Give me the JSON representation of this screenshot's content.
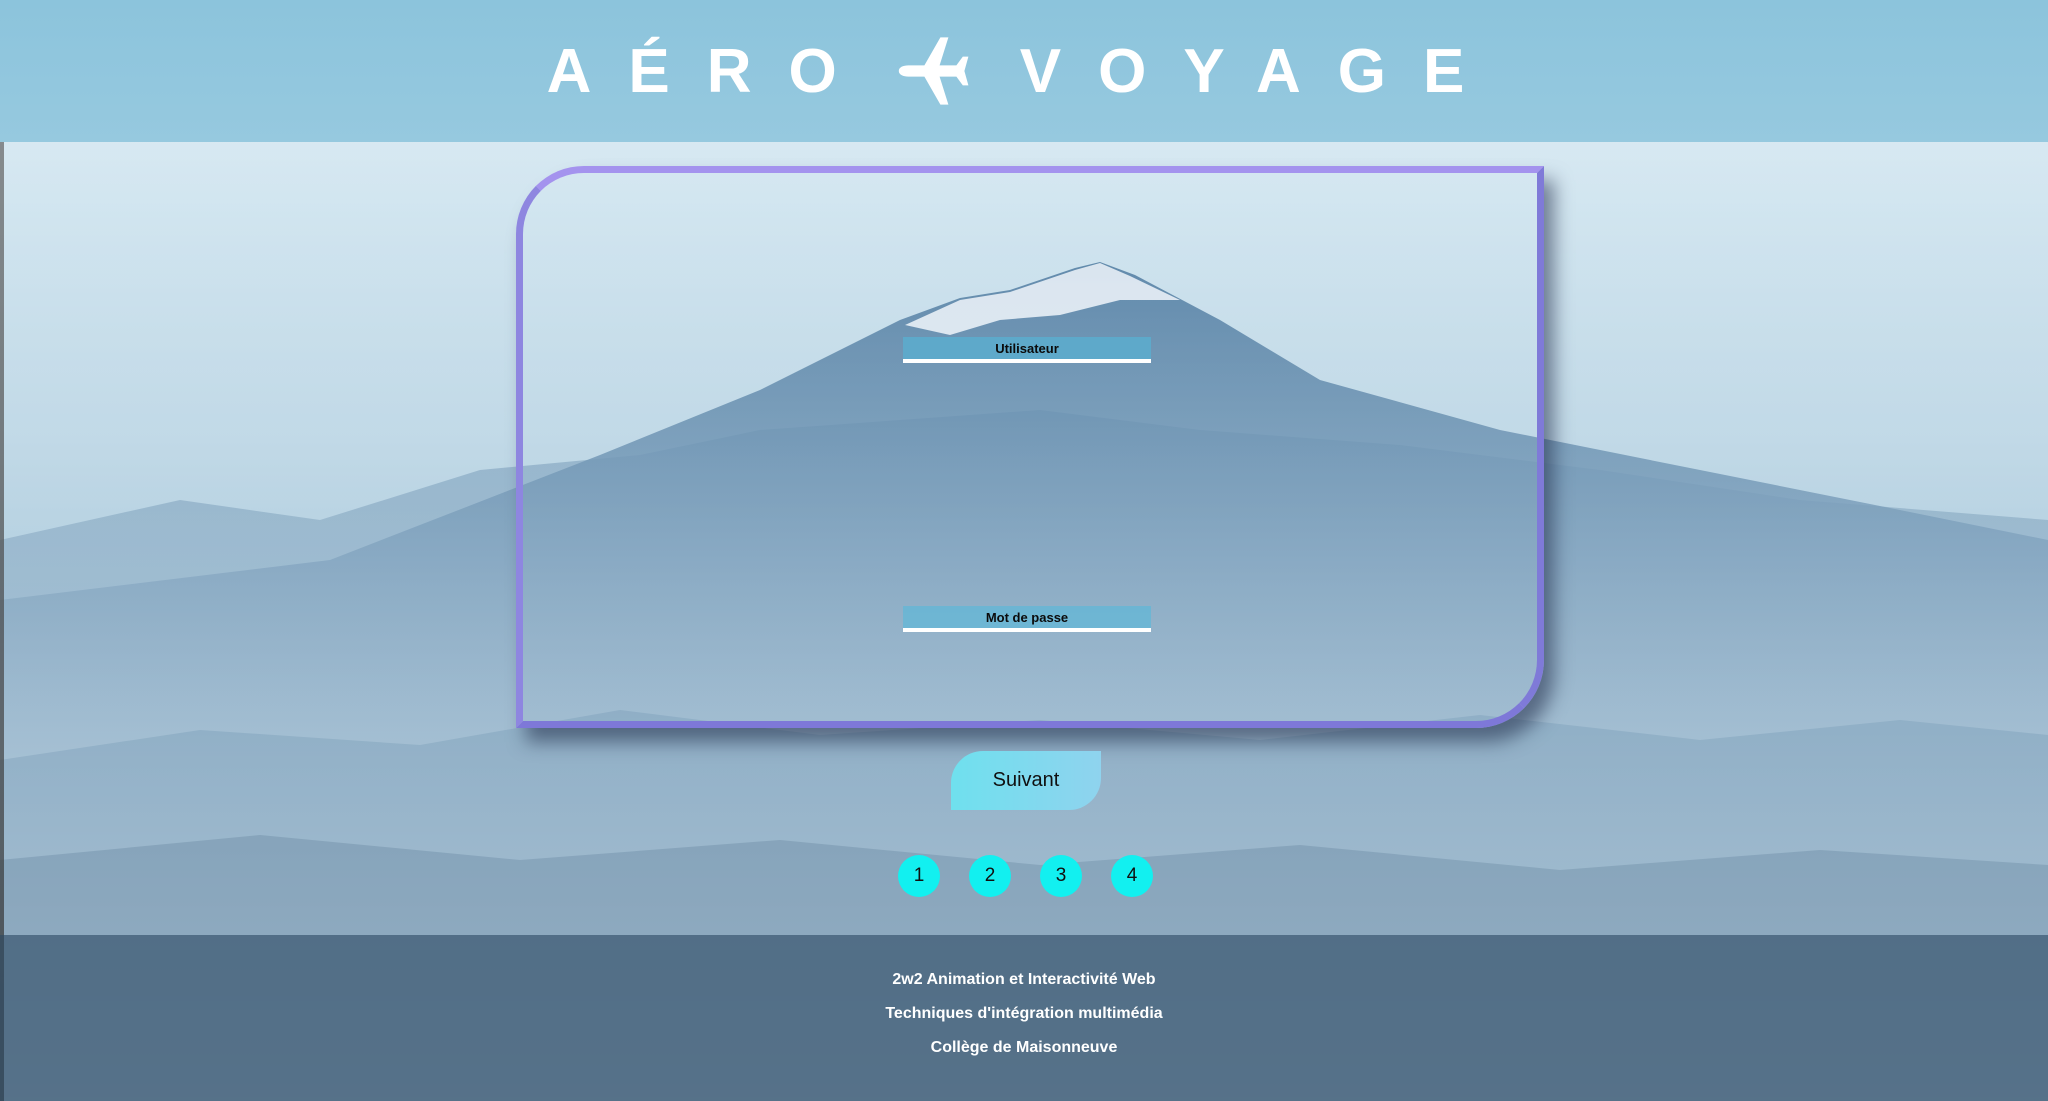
{
  "header": {
    "brand_left": "AÉRO",
    "brand_icon": "airplane-icon",
    "brand_right": "VOYAGE"
  },
  "form": {
    "username_label": "Utilisateur",
    "password_label": "Mot de passe"
  },
  "actions": {
    "next_label": "Suivant"
  },
  "pagination": {
    "pages": [
      "1",
      "2",
      "3",
      "4"
    ]
  },
  "footer": {
    "lines": [
      "2w2 Animation et Interactivité Web",
      "Techniques d'intégration multimédia",
      "Collège de Maisonneuve"
    ]
  },
  "colors": {
    "header": "#8cc4dc",
    "card_border": "#8e86e0",
    "button": "#6fe0ee",
    "page_dot": "#12f0f0",
    "footer": "#2d4b64"
  }
}
